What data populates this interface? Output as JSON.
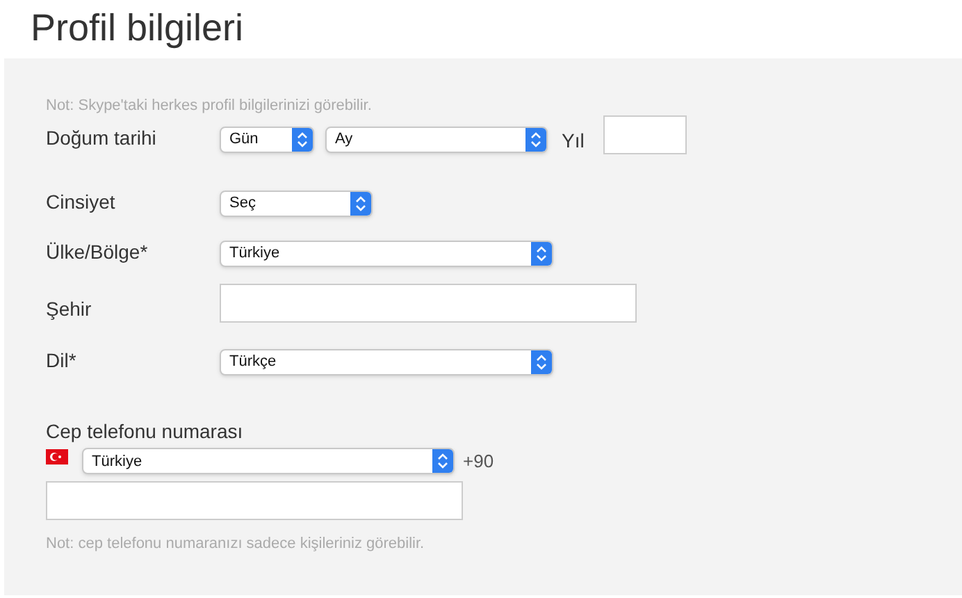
{
  "title": "Profil bilgileri",
  "note": "Not: Skype'taki herkes profil bilgilerinizi görebilir.",
  "fields": [
    {
      "label": "Doğum tarihi",
      "controls": [
        {
          "kind": "day-select",
          "value": "Gün"
        },
        {
          "kind": "month-select",
          "value": "Ay"
        },
        {
          "kind": "caption",
          "text": "Yıl"
        },
        {
          "kind": "year-input"
        }
      ]
    },
    {
      "label": "Cinsiyet",
      "controls": [
        {
          "kind": "short-select",
          "value": "Seç"
        }
      ]
    },
    {
      "label": "Ülke/Bölge*",
      "controls": [
        {
          "kind": "select",
          "value": "Türkiye"
        }
      ]
    },
    {
      "label": "Şehir",
      "controls": [
        {
          "kind": "text-input"
        }
      ]
    },
    {
      "label": "Dil*",
      "controls": [
        {
          "kind": "select",
          "value": "Türkçe"
        }
      ]
    }
  ],
  "phone": {
    "label": "Cep telefonu numarası",
    "country": "Türkiye",
    "code": "+90",
    "note": "Not: cep telefonu numaranızı sadece kişileriniz görebilir."
  }
}
